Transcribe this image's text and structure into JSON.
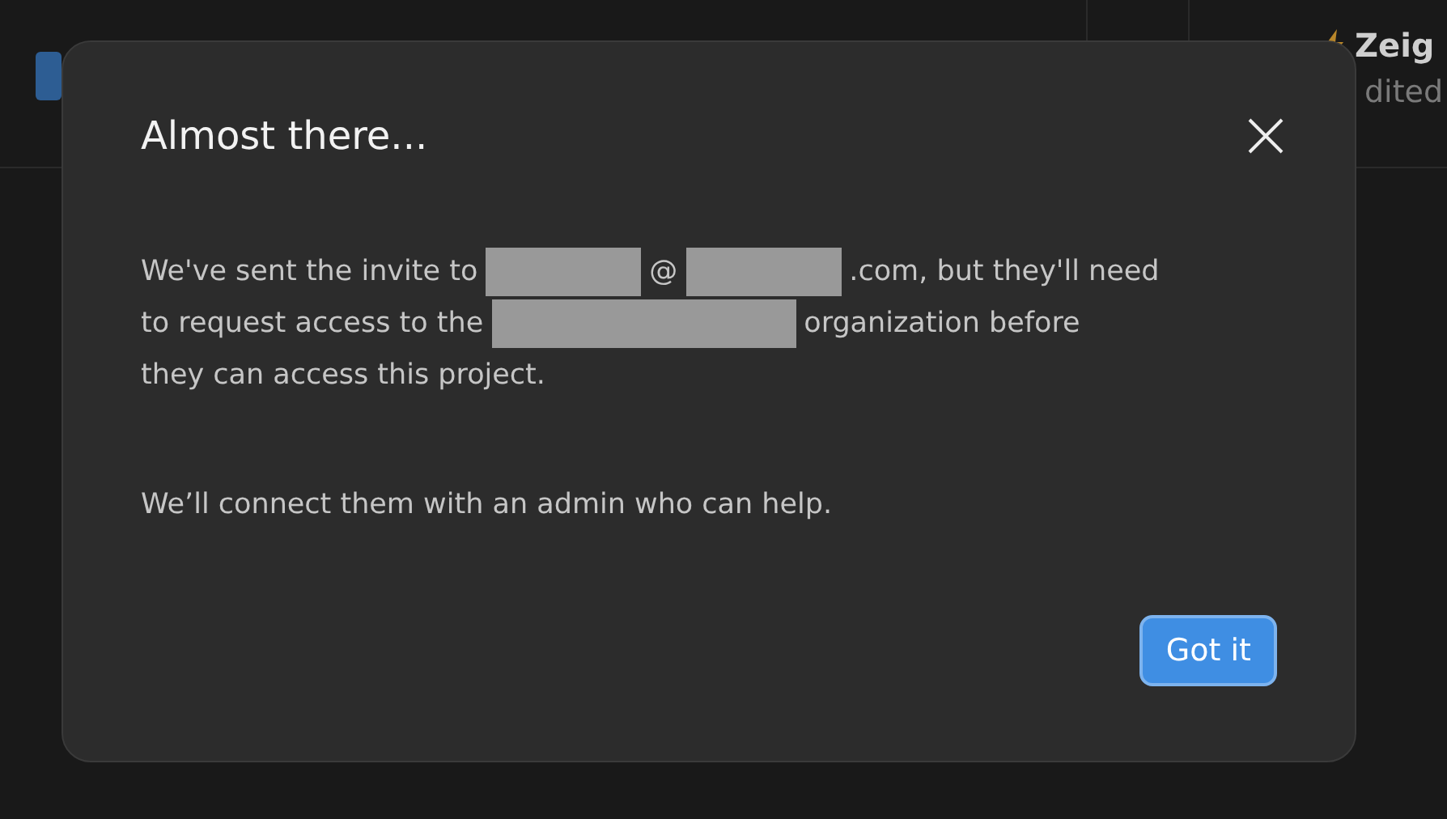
{
  "background": {
    "project_name": "Zeig",
    "project_meta": "dited"
  },
  "dialog": {
    "title": "Almost there...",
    "paragraphs": [
      [
        [
          {
            "kind": "text",
            "text": "We've sent the invite to"
          },
          {
            "kind": "redacted"
          },
          {
            "kind": "text",
            "text": "@"
          },
          {
            "kind": "redacted"
          },
          {
            "kind": "text",
            "text": ".com, but they'll need"
          }
        ],
        [
          {
            "kind": "text",
            "text": "to request access to the"
          },
          {
            "kind": "redacted_wide"
          },
          {
            "kind": "text",
            "text": "organization before"
          }
        ],
        [
          {
            "kind": "text",
            "text": "they can access this project."
          }
        ]
      ],
      [
        [
          {
            "kind": "text",
            "text": "We’ll connect them with an admin who can help."
          }
        ]
      ]
    ],
    "button": "Got it"
  }
}
